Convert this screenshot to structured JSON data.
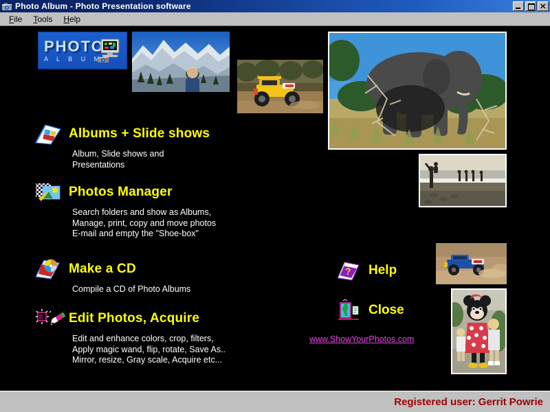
{
  "window": {
    "title": "Photo Album  -   Photo Presentation software",
    "app_icon": "camera-icon",
    "buttons": {
      "minimize": "minimize-icon",
      "maximize": "restore-icon",
      "close": "close-icon"
    }
  },
  "menubar": {
    "items": [
      {
        "label": "File",
        "accel": "F"
      },
      {
        "label": "Tools",
        "accel": "T"
      },
      {
        "label": "Help",
        "accel": "H"
      }
    ]
  },
  "logo": {
    "word_main": "PHOTO",
    "word_sub": "A L B U M",
    "icon": "computer-camera-icon",
    "bg_color": "#1550bb"
  },
  "features": [
    {
      "icon": "album-book-icon",
      "title": "Albums + Slide shows",
      "description": "Album, Slide shows and\nPresentations"
    },
    {
      "icon": "photo-manager-icon",
      "title": "Photos Manager",
      "description": "Search folders and show as Albums,\nManage, print, copy and move photos\nE-mail and empty the \"Shoe-box\""
    },
    {
      "icon": "cd-book-icon",
      "title": "Make a CD",
      "description": "Compile a CD of Photo Albums"
    },
    {
      "icon": "magic-wand-icon",
      "title": "Edit Photos, Acquire",
      "description": "Edit and enhance colors,  crop, filters,\nApply magic wand, flip, rotate, Save As..\nMirror, resize, Gray scale, Acquire etc..."
    }
  ],
  "actions": [
    {
      "icon": "help-book-icon",
      "label": "Help"
    },
    {
      "icon": "exit-door-icon",
      "label": "Close"
    }
  ],
  "weblink": {
    "text": "www.ShowYourPhotos.com",
    "color": "#e845e8"
  },
  "photos": [
    {
      "name": "snowy-mountain-photo",
      "alt": "Man on snow covered mountain ridge"
    },
    {
      "name": "yellow-buggy-photo",
      "alt": "Yellow off-road racing buggy on dirt track"
    },
    {
      "name": "elephant-photo",
      "alt": "Elephant in bushveld under blue sky"
    },
    {
      "name": "beach-photo",
      "alt": "People wading at the beach at dusk"
    },
    {
      "name": "blue-truck-photo",
      "alt": "Blue off-road racing truck on sand"
    },
    {
      "name": "minnie-mouse-photo",
      "alt": "Children with Minnie Mouse character"
    }
  ],
  "statusbar": {
    "registered_user": "Registered user: Gerrit Powrie",
    "text_color": "#9e0000"
  },
  "theme": {
    "title_bar": "#0a246a",
    "menu_bar": "#c0c0c0",
    "canvas": "#000000",
    "heading": "#ffff00",
    "body_text": "#ffffff"
  }
}
